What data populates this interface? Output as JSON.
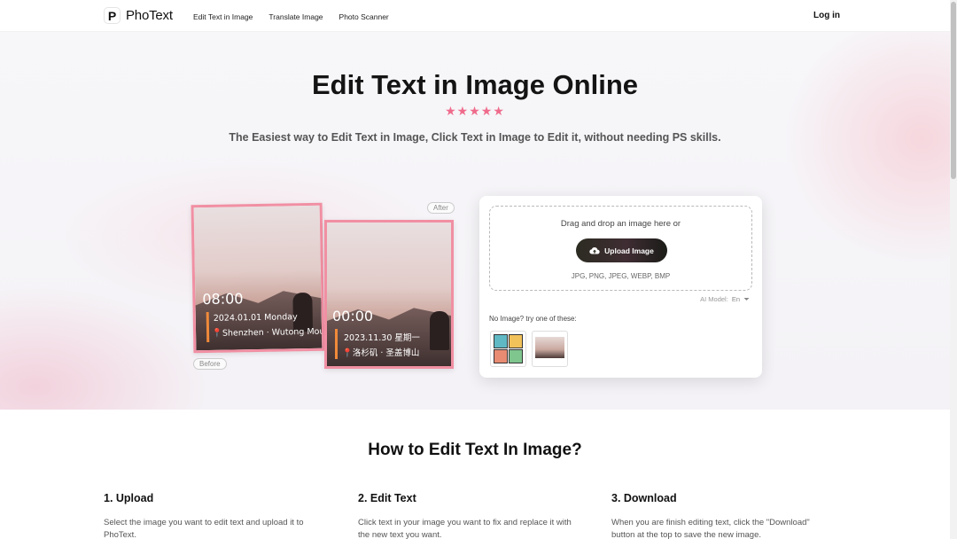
{
  "header": {
    "brand": "PhoText",
    "logo_letter": "P",
    "nav": [
      "Edit Text in Image",
      "Translate Image",
      "Photo Scanner"
    ],
    "login": "Log in"
  },
  "hero": {
    "title": "Edit Text in Image Online",
    "stars": "★★★★★",
    "rating": 5,
    "subtitle": "The Easiest way to Edit Text in Image, Click Text in Image to Edit it, without needing PS skills.",
    "star_color": "#ef6b8b"
  },
  "demo": {
    "before_tag": "Before",
    "after_tag": "After",
    "before": {
      "time": "08:00",
      "date": "2024.01.01 Monday",
      "location": "📍Shenzhen · Wutong Moun"
    },
    "after": {
      "time": "00:00",
      "date": "2023.11.30 星期一",
      "location": "📍洛杉矶 · 圣盖博山"
    }
  },
  "upload": {
    "drag_text": "Drag and drop an image here or",
    "button_label": "Upload Image",
    "button_icon": "cloud-upload-icon",
    "formats": "JPG, PNG, JPEG, WEBP, BMP",
    "ai_model_label": "AI Model:",
    "ai_model_value": "En",
    "sample_label": "No Image? try one of these:"
  },
  "howto": {
    "title": "How to Edit Text In Image?",
    "steps": [
      {
        "title": "1. Upload",
        "text": "Select the image you want to edit text and upload it to PhoText."
      },
      {
        "title": "2. Edit Text",
        "text": "Click text in your image you want to fix and replace it with the new text you want."
      },
      {
        "title": "3. Download",
        "text": "When you are finish editing text, click the \"Download\" button at the top to save the new image."
      }
    ]
  }
}
